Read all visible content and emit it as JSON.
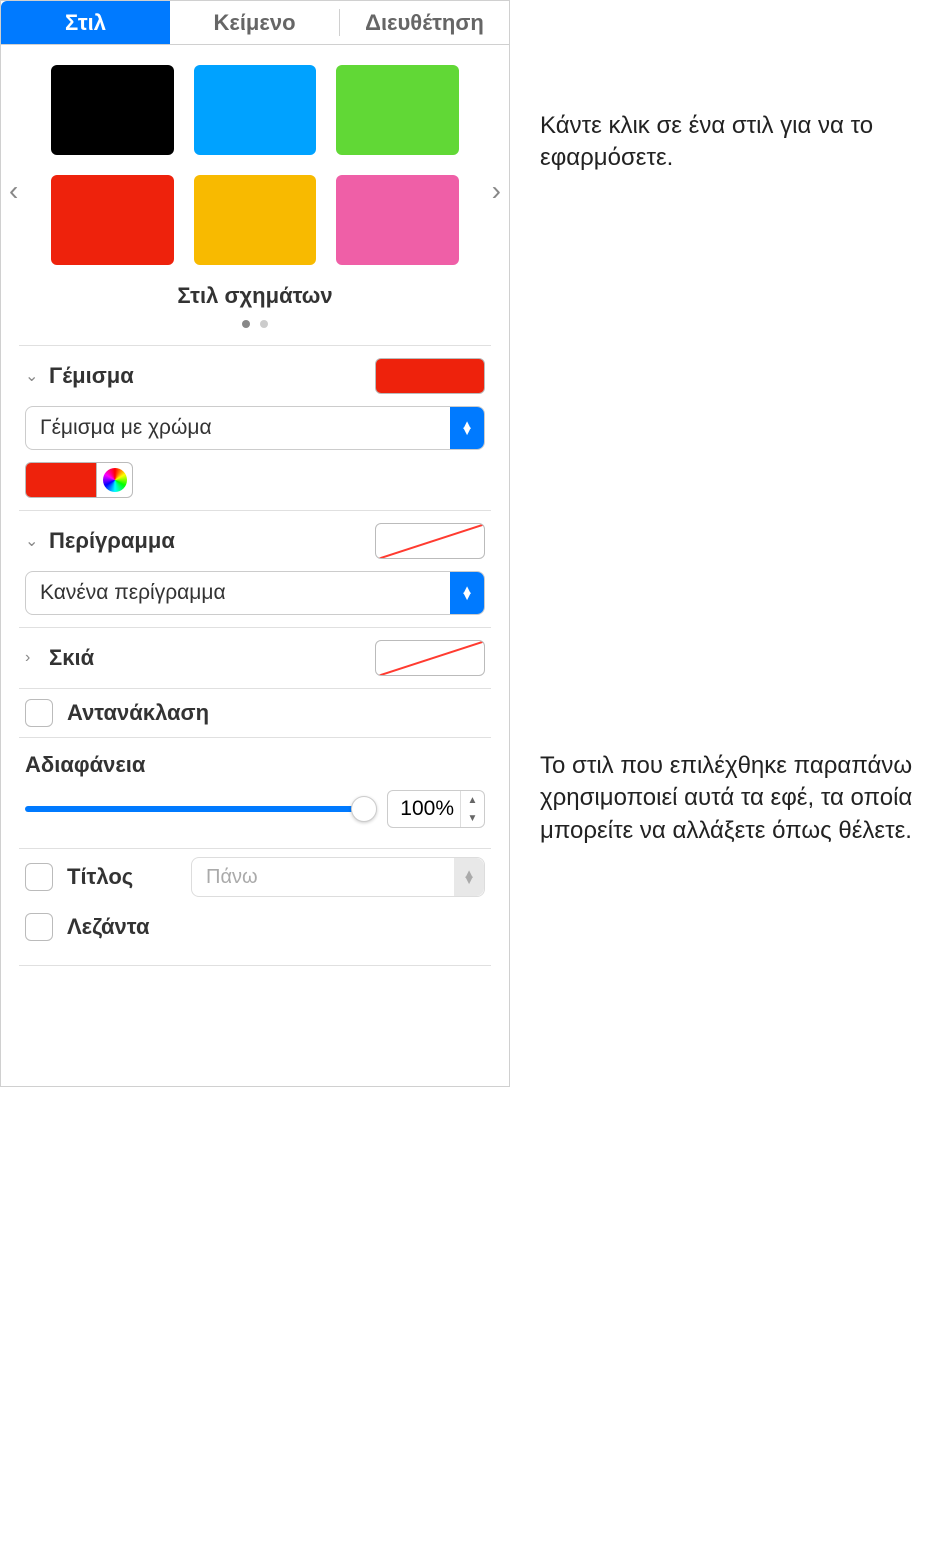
{
  "tabs": {
    "style": "Στιλ",
    "text": "Κείμενο",
    "arrange": "Διευθέτηση"
  },
  "styles": {
    "label": "Στιλ σχημάτων",
    "swatches": [
      "#000000",
      "#00a2ff",
      "#61d836",
      "#ee220c",
      "#f8ba00",
      "#ef5fa7"
    ]
  },
  "fill": {
    "label": "Γέμισμα",
    "color": "#ee220c",
    "popup": "Γέμισμα με χρώμα"
  },
  "border": {
    "label": "Περίγραμμα",
    "popup": "Κανένα περίγραμμα"
  },
  "shadow": {
    "label": "Σκιά"
  },
  "reflection": {
    "label": "Αντανάκλαση"
  },
  "opacity": {
    "label": "Αδιαφάνεια",
    "value": "100%"
  },
  "title": {
    "label": "Τίτλος",
    "position": "Πάνω"
  },
  "caption": {
    "label": "Λεζάντα"
  },
  "callouts": {
    "c1": "Κάντε κλικ σε ένα στιλ για να το εφαρμόσετε.",
    "c2": "Το στιλ που επιλέχθηκε παραπάνω χρησιμοποιεί αυτά τα εφέ, τα οποία μπορείτε να αλλάξετε όπως θέλετε."
  }
}
